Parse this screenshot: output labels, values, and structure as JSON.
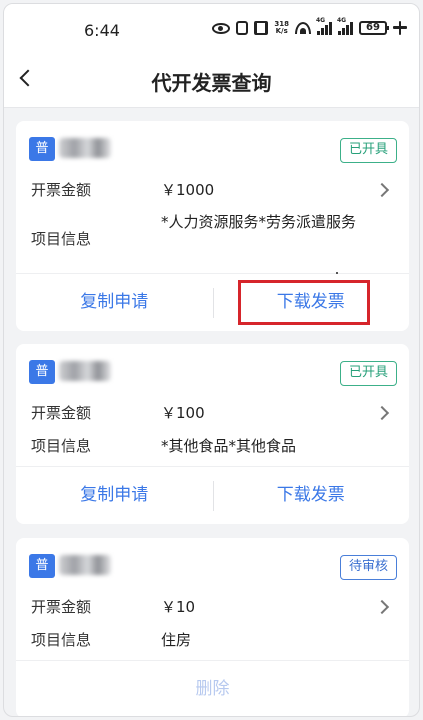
{
  "status_bar": {
    "time": "6:44",
    "net_speed": "318\nK/s",
    "signal1_label": "4G",
    "signal2_label": "4G",
    "battery": "69"
  },
  "header": {
    "title": "代开发票查询"
  },
  "labels": {
    "amount": "开票金额",
    "project": "项目信息"
  },
  "cards": [
    {
      "type_tag": "普",
      "status": "已开具",
      "amount": "￥1000",
      "project": "*人力资源服务*劳务派遣服务",
      "actions": [
        "复制申请",
        "下载发票"
      ]
    },
    {
      "type_tag": "普",
      "status": "已开具",
      "amount": "￥100",
      "project": "*其他食品*其他食品",
      "actions": [
        "复制申请",
        "下载发票"
      ]
    },
    {
      "type_tag": "普",
      "status": "待审核",
      "amount": "￥10",
      "project": "住房",
      "actions": [
        "删除"
      ]
    }
  ],
  "colors": {
    "accent": "#3b78e7",
    "issued": "#27a07a",
    "pending": "#3a6fd0",
    "highlight": "#d6252b"
  }
}
